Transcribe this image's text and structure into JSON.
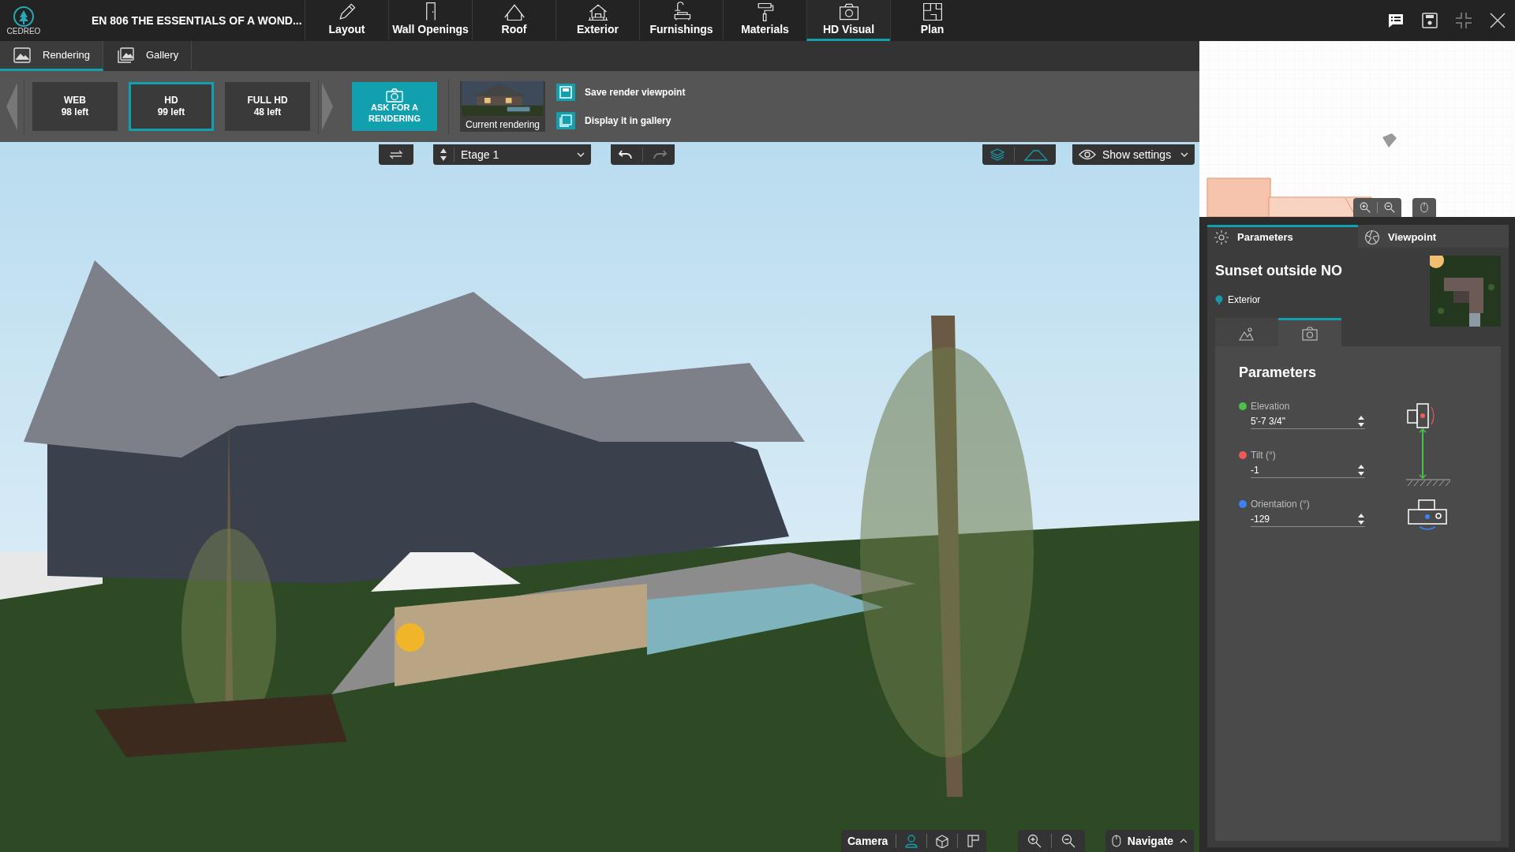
{
  "app": {
    "logo": "CEDREO",
    "project_title": "EN 806 THE ESSENTIALS OF A WOND..."
  },
  "nav_tabs": [
    {
      "label": "Layout",
      "selected": false
    },
    {
      "label": "Wall Openings",
      "selected": false
    },
    {
      "label": "Roof",
      "selected": false
    },
    {
      "label": "Exterior",
      "selected": false
    },
    {
      "label": "Furnishings",
      "selected": false
    },
    {
      "label": "Materials",
      "selected": false
    },
    {
      "label": "HD Visual",
      "selected": true
    },
    {
      "label": "Plan",
      "selected": false
    }
  ],
  "sub_tabs": [
    {
      "label": "Rendering",
      "selected": true
    },
    {
      "label": "Gallery",
      "selected": false
    }
  ],
  "quality_options": [
    {
      "name": "WEB",
      "remaining": "98 left",
      "selected": false
    },
    {
      "name": "HD",
      "remaining": "99 left",
      "selected": true
    },
    {
      "name": "FULL HD",
      "remaining": "48 left",
      "selected": false
    }
  ],
  "render_button": "ASK FOR A RENDERING",
  "current_rendering": "Current rendering",
  "render_actions": [
    "Save render viewpoint",
    "Display it in gallery"
  ],
  "viewport_toolbar": {
    "floor": "Etage 1",
    "show_settings": "Show settings"
  },
  "bottom_bar": {
    "camera_label": "Camera",
    "camera_modes": [
      {
        "selected": true
      },
      {
        "selected": false
      },
      {
        "selected": false
      }
    ],
    "navigate_label": "Navigate"
  },
  "side_panel": {
    "tabs": [
      {
        "label": "Parameters",
        "selected": true
      },
      {
        "label": "Viewpoint",
        "selected": false
      }
    ],
    "title": "Sunset outside NO",
    "category": "Exterior",
    "sub_tabs": [
      {
        "selected": false
      },
      {
        "selected": true
      }
    ],
    "section_title": "Parameters",
    "fields": [
      {
        "label": "Elevation",
        "value": "5'-7 3/4\"",
        "color": "#4cc04c"
      },
      {
        "label": "Tilt (°)",
        "value": "-1",
        "color": "#ee5a5a"
      },
      {
        "label": "Orientation (°)",
        "value": "-129",
        "color": "#3b82f6"
      }
    ]
  }
}
